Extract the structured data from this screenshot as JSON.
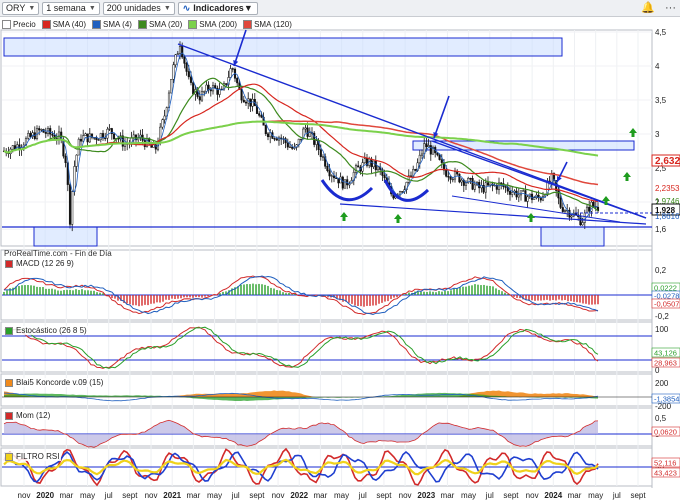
{
  "toolbar": {
    "ticker": "ORY",
    "period": "1 semana",
    "units": "200 unidades",
    "indicators_label": "Indicadores"
  },
  "legend": [
    {
      "label": "Precio",
      "color": "#ffffff"
    },
    {
      "label": "SMA (40)",
      "color": "#d7261e"
    },
    {
      "label": "SMA (4)",
      "color": "#1f5fbf"
    },
    {
      "label": "SMA (20)",
      "color": "#3d8a1e"
    },
    {
      "label": "SMA (200)",
      "color": "#7bd14b"
    },
    {
      "label": "SMA (120)",
      "color": "#e0483c"
    }
  ],
  "attribution": "ProRealTime.com - Fin de Día",
  "price_axis": {
    "ticks": [
      "4,5",
      "4",
      "3,5",
      "3",
      "2,5",
      "2",
      "1,6"
    ],
    "badges": [
      {
        "label": "2,632",
        "color": "#d7261e"
      },
      {
        "label": "2,2353",
        "color": "#d7261e"
      },
      {
        "label": "1,9746",
        "color": "#3d8a1e"
      },
      {
        "label": "1,928",
        "color": "#111111"
      },
      {
        "label": "1,8616",
        "color": "#1f5fbf"
      }
    ]
  },
  "panels": [
    {
      "key": "macd",
      "title": "MACD (12 26 9)",
      "ticks": [
        "0,2",
        "0",
        "-0,2"
      ],
      "badges": [
        "0,0222",
        "-0,0278",
        "-0,0507"
      ]
    },
    {
      "key": "stoch",
      "title": "Estocástico (26 8 5)",
      "ticks": [
        "100",
        "0"
      ],
      "badges": [
        "43,126",
        "28,963"
      ]
    },
    {
      "key": "blai5",
      "title": "Blai5 Koncorde v.09 (15)",
      "ticks": [
        "200",
        "0",
        "-200"
      ],
      "badges": [
        "-1,3854"
      ]
    },
    {
      "key": "mom",
      "title": "Mom (12)",
      "ticks": [
        "0,5",
        "0"
      ],
      "badges": [
        "0,0620"
      ]
    },
    {
      "key": "rsi",
      "title": "FILTRO RSI",
      "ticks": [
        "50"
      ],
      "badges": [
        "52,116",
        "43,423"
      ]
    }
  ],
  "time_axis": [
    "nov",
    "2020",
    "mar",
    "may",
    "jul",
    "sept",
    "nov",
    "2021",
    "mar",
    "may",
    "jul",
    "sept",
    "nov",
    "2022",
    "mar",
    "may",
    "jul",
    "sept",
    "nov",
    "2023",
    "mar",
    "may",
    "jul",
    "sept",
    "nov",
    "2024",
    "mar",
    "may",
    "jul",
    "sept"
  ],
  "colors": {
    "candle_up": "#ffffff",
    "candle_down": "#111111",
    "trendline": "#1a2bd0",
    "zone_fill": "#c9dcff",
    "arrow_up": "#1e9c1e",
    "macd_hist_pos": "#2aa02a",
    "macd_hist_neg": "#d22a2a"
  }
}
